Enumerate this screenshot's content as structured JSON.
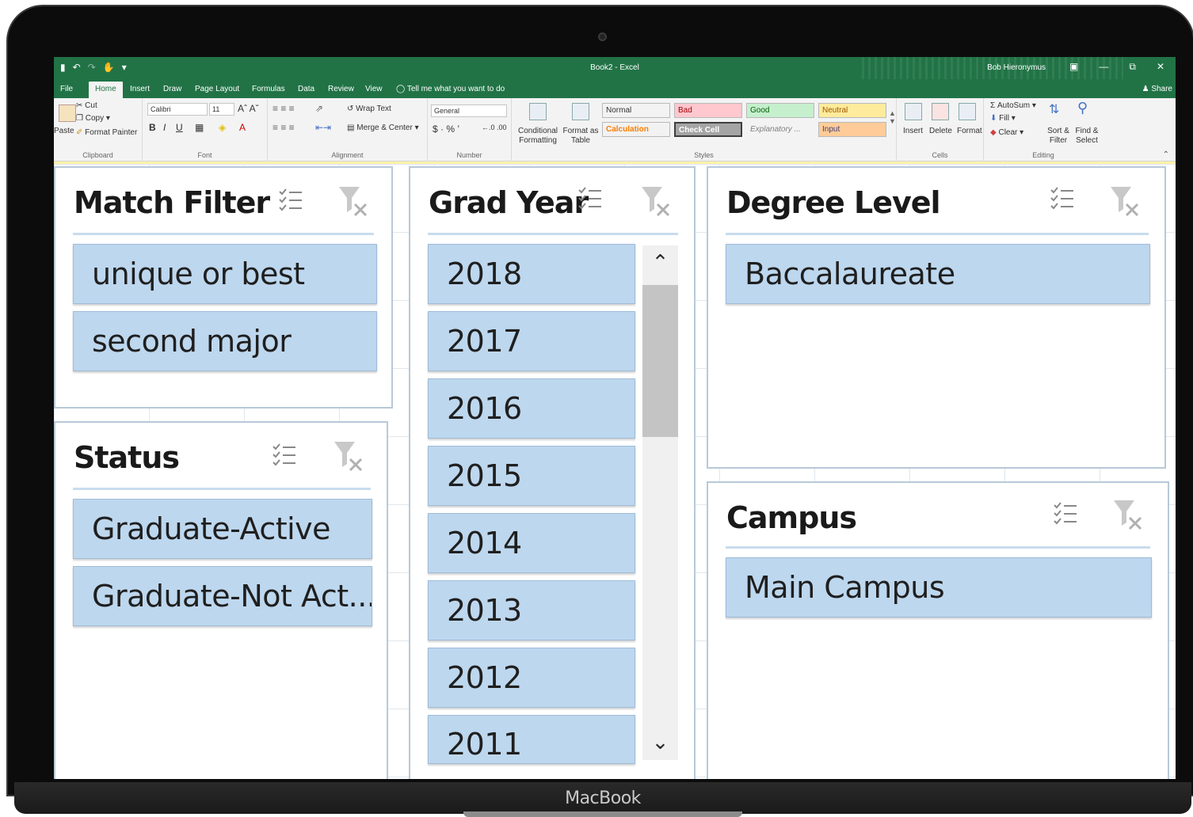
{
  "device": {
    "label": "MacBook"
  },
  "titlebar": {
    "title": "Book2 - Excel",
    "user": "Bob Hieronymus"
  },
  "tabs": [
    "File",
    "Home",
    "Insert",
    "Draw",
    "Page Layout",
    "Formulas",
    "Data",
    "Review",
    "View"
  ],
  "tell_me": "Tell me what you want to do",
  "share": "Share",
  "ribbon": {
    "clipboard": {
      "paste": "Paste",
      "cut": "Cut",
      "copy": "Copy",
      "format_painter": "Format Painter",
      "label": "Clipboard"
    },
    "font": {
      "name": "Calibri",
      "size": "11",
      "label": "Font"
    },
    "alignment": {
      "wrap": "Wrap Text",
      "merge": "Merge & Center",
      "label": "Alignment"
    },
    "number": {
      "format": "General",
      "label": "Number"
    },
    "styles": {
      "conditional": "Conditional Formatting",
      "format_table": "Format as Table",
      "cells": [
        {
          "text": "Normal",
          "bg": "#ffffff",
          "fg": "#000000"
        },
        {
          "text": "Bad",
          "bg": "#ffc7ce",
          "fg": "#9c0006"
        },
        {
          "text": "Good",
          "bg": "#c6efce",
          "fg": "#006100"
        },
        {
          "text": "Neutral",
          "bg": "#ffeb9c",
          "fg": "#9c5700"
        },
        {
          "text": "Calculation",
          "bg": "#f2f2f2",
          "fg": "#fa7d00"
        },
        {
          "text": "Check Cell",
          "bg": "#a5a5a5",
          "fg": "#ffffff"
        },
        {
          "text": "Explanatory ...",
          "bg": "#ffffff",
          "fg": "#7f7f7f"
        },
        {
          "text": "Input",
          "bg": "#ffcc99",
          "fg": "#3f3f76"
        }
      ],
      "label": "Styles"
    },
    "cells": {
      "insert": "Insert",
      "delete": "Delete",
      "format": "Format",
      "label": "Cells"
    },
    "editing": {
      "autosum": "AutoSum",
      "fill": "Fill",
      "clear": "Clear",
      "sort": "Sort & Filter",
      "find": "Find & Select",
      "label": "Editing"
    }
  },
  "slicers": {
    "match_filter": {
      "title": "Match Filter",
      "items": [
        "unique or best",
        "second major"
      ]
    },
    "status": {
      "title": "Status",
      "items": [
        "Graduate-Active",
        "Graduate-Not Act..."
      ]
    },
    "grad_year": {
      "title": "Grad Year",
      "items": [
        "2018",
        "2017",
        "2016",
        "2015",
        "2014",
        "2013",
        "2012",
        "2011"
      ]
    },
    "degree_level": {
      "title": "Degree Level",
      "items": [
        "Baccalaureate"
      ]
    },
    "campus": {
      "title": "Campus",
      "items": [
        "Main Campus"
      ]
    }
  },
  "colors": {
    "excel_green": "#217346",
    "slicer_item": "#bdd7ee"
  }
}
